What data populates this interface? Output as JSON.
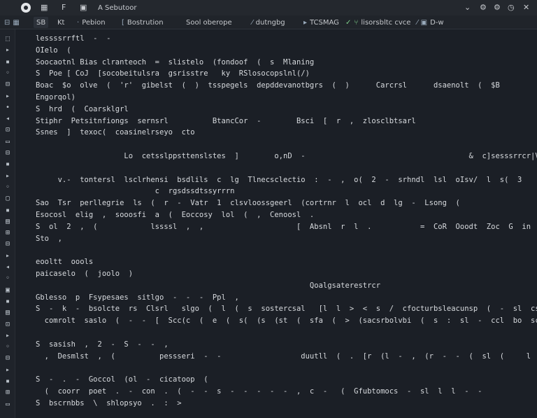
{
  "title_bar": {
    "app_title": "A Sebutoor",
    "icon_menu": "▦",
    "icon_file": "F",
    "icon_edit": "▣",
    "icon_minimize": "⌄",
    "icon_settings": "⚙",
    "icon_reload": "◷",
    "icon_close": "✕"
  },
  "toolbar": {
    "items": [
      {
        "label": "SB"
      },
      {
        "label": "Kt"
      },
      {
        "label": "Pebion"
      },
      {
        "label": "Bostrution"
      },
      {
        "label": "Sool oberope"
      },
      {
        "label": "dutngbg"
      },
      {
        "label": "TCSMAG"
      },
      {
        "label": "lisorsbltc cvce"
      },
      {
        "label": "D-w"
      }
    ]
  },
  "editor": {
    "lines": [
      {
        "n": "",
        "segs": [
          {
            "t": "lessssrrftl  -  -",
            "c": "c-white"
          }
        ]
      },
      {
        "n": "",
        "segs": [
          {
            "t": "OIelo  (",
            "c": "c-white"
          }
        ]
      },
      {
        "n": "",
        "segs": [
          {
            "t": "Soocaotnl Bias clranteoch  =  slistelo  (fondoof  (  s  Mlaning",
            "c": "c-white"
          }
        ]
      },
      {
        "n": "",
        "segs": [
          {
            "t": "S  Poe [ CoJ  [socobeitulsra  gsrisstre   ky  RSlosocopslnl(/)",
            "c": "c-white"
          }
        ]
      },
      {
        "n": "",
        "segs": [
          {
            "t": "Boac  $o  olve  (  'r'  gibelst  (  )  tsspegels  depddevanotbgrs  (  )      Carcrsl      dsaenolt  (  $B",
            "c": "c-white"
          }
        ]
      },
      {
        "n": "",
        "segs": [
          {
            "t": "Engorqol)",
            "c": "c-white"
          }
        ]
      },
      {
        "n": "",
        "segs": [
          {
            "t": "S  hrd  (  Coarsklgrl",
            "c": "c-white"
          }
        ]
      },
      {
        "n": "",
        "segs": [
          {
            "t": "Stiphr  Petsitnfiongs  sernsrl          BtancCor  -        Bsci  [  r  ,  zlosclbtsarl",
            "c": "c-white"
          }
        ]
      },
      {
        "n": "",
        "segs": [
          {
            "t": "Ssnes  ]  texoc(  coasinelrseyo  cto",
            "c": "c-white"
          }
        ]
      },
      {
        "n": "",
        "segs": [
          {
            "t": "",
            "c": "c-white"
          }
        ]
      },
      {
        "n": "",
        "segs": [
          {
            "t": "                    Lo  cetsslppsttenslstes  ]        o,nD  -                                     &  c]sesssrrcr|V|rl   -      -cl   ,",
            "c": "c-white"
          }
        ]
      },
      {
        "n": "",
        "segs": [
          {
            "t": "",
            "c": "c-white"
          }
        ]
      },
      {
        "n": "",
        "segs": [
          {
            "t": "     v.-  tontersl  lsclrhensi  bsdlils  c  lg  Tlnecsclectio  :  -  ,  o(  2  -  srhndl  lsl  oIsv/  l  s(  3",
            "c": "c-white"
          }
        ]
      },
      {
        "n": "",
        "segs": [
          {
            "t": "                           c  rgsdssdtssyrrrn",
            "c": "c-white"
          }
        ]
      },
      {
        "n": "",
        "segs": [
          {
            "t": "Sao  Tsr  perllegrie  ls  (  r  -  Vatr  1  clsvloossgeerl  (cortrnr  l  ocl  d  lg  -  Lsong  (",
            "c": "c-white"
          }
        ]
      },
      {
        "n": "",
        "segs": [
          {
            "t": "Esocosl  elig  ,  sooosfi  a  (  Eoccosy  lol  (  ,  Cenoosl  .",
            "c": "c-white"
          }
        ]
      },
      {
        "n": "",
        "segs": [
          {
            "t": "S  ol  2  ,  (            lssssl  ,  ,                     [  Absnl  r  l  .           =  CoR  Ooodt  Zoc  G  in  C)  -",
            "c": "c-white"
          }
        ]
      },
      {
        "n": "",
        "segs": [
          {
            "t": "Sto  ,",
            "c": "c-white"
          }
        ]
      },
      {
        "n": "",
        "segs": [
          {
            "t": "",
            "c": "c-white"
          }
        ]
      },
      {
        "n": "",
        "segs": [
          {
            "t": "eooltt  oools",
            "c": "c-white"
          }
        ]
      },
      {
        "n": "",
        "segs": [
          {
            "t": "paicaselo  (  joolo  )",
            "c": "c-white"
          }
        ]
      },
      {
        "n": "",
        "segs": [
          {
            "t": "                                                              Qoalgsaterestrcr",
            "c": "c-white"
          }
        ]
      },
      {
        "n": "",
        "segs": [
          {
            "t": "Gblesso  p  Fsypesaes  sitlgo  -  -  -  Ppl  ,",
            "c": "c-white"
          }
        ]
      },
      {
        "n": "",
        "segs": [
          {
            "t": "S  -  k  -  bsolcte  rs  Clsrl   slgo  (  l  (  s  sostercsal   [l  l  >  <  s  /  cfocturbsleacunsp  (  -  sl  cs  -  :  sl",
            "c": "c-white"
          }
        ]
      },
      {
        "n": "",
        "segs": [
          {
            "t": "  comrolt  saslo  (  -  -  [  Scc(c  (  e  (  s(  (s  (st  (  sfa  (  >  (sacsrbolvbi  (  s  :  sl  -  ccl  bo  scoo  (ro  (  l  (  c  ,  s",
            "c": "c-white"
          }
        ]
      },
      {
        "n": "",
        "segs": [
          {
            "t": "",
            "c": "c-white"
          }
        ]
      },
      {
        "n": "",
        "segs": [
          {
            "t": "S  sasish  ,  2  -  S  -  -  ,",
            "c": "c-white"
          }
        ]
      },
      {
        "n": "",
        "segs": [
          {
            "t": "  ,  Desmlst  ,  (          pessseri  -  -                  duutll  (  .  [r  (l  -  ,  (r  -  -  (  sl  (     l  -  sl  -  -  .  ,",
            "c": "c-white"
          }
        ]
      },
      {
        "n": "",
        "segs": [
          {
            "t": "",
            "c": "c-white"
          }
        ]
      },
      {
        "n": "",
        "segs": [
          {
            "t": "S  -  .  -  Goccol  (ol  -  cicatoop  (",
            "c": "c-white"
          }
        ]
      },
      {
        "n": "",
        "segs": [
          {
            "t": "  (  coorr  poet  .  -  con  .  (  -  -  s  -  -  -  -  -  ,  c  -   (  Gfubtomocs  -  sl  l  l  -  -",
            "c": "c-white"
          }
        ]
      },
      {
        "n": "",
        "segs": [
          {
            "t": "S  bscrnbbs  \\  shlopsyo  .  :  >",
            "c": "c-white"
          }
        ]
      },
      {
        "n": "",
        "segs": [
          {
            "t": "",
            "c": "c-white"
          }
        ]
      }
    ]
  },
  "rail_icons": [
    "⬚",
    "▸",
    "▪",
    "◦",
    "⊟",
    "▸",
    "•",
    "◂",
    "⊡",
    "▭",
    "⊟",
    "▪",
    "▸",
    "◦",
    "▢",
    "▪",
    "▤",
    "⊞",
    "⊟",
    "▸",
    "◂",
    "◦",
    "▣",
    "▪",
    "▤",
    "⊡",
    "▸",
    "◦",
    "⊟",
    "▸",
    "▪",
    "⊞",
    "▭"
  ]
}
